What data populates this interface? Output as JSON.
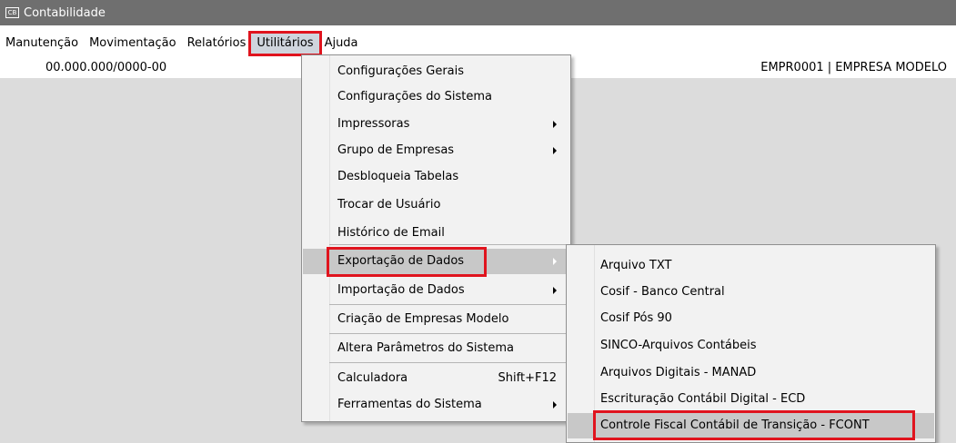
{
  "window": {
    "title": "Contabilidade",
    "icon": "window-app-icon"
  },
  "menubar": {
    "items": [
      {
        "label": "Manutenção"
      },
      {
        "label": "Movimentação"
      },
      {
        "label": "Relatórios"
      },
      {
        "label": "Utilitários"
      },
      {
        "label": "Ajuda"
      }
    ]
  },
  "infobar": {
    "cnpj": "00.000.000/0000-00",
    "empresa": "EMPR0001 | EMPRESA MODELO"
  },
  "utilitarios_menu": {
    "items": [
      {
        "label": "Configurações Gerais"
      },
      {
        "label": "Configurações do Sistema"
      },
      {
        "label": "Impressoras"
      },
      {
        "label": "Grupo de Empresas"
      },
      {
        "label": "Desbloqueia Tabelas"
      },
      {
        "label": "Trocar de Usuário"
      },
      {
        "label": "Histórico de Email"
      },
      {
        "label": "Exportação de Dados"
      },
      {
        "label": "Importação de Dados"
      },
      {
        "label": "Criação de Empresas Modelo"
      },
      {
        "label": "Altera Parâmetros do Sistema"
      },
      {
        "label": "Calculadora",
        "shortcut": "Shift+F12"
      },
      {
        "label": "Ferramentas do Sistema"
      }
    ]
  },
  "exportacao_submenu": {
    "items": [
      {
        "label": "Arquivo TXT"
      },
      {
        "label": "Cosif - Banco Central"
      },
      {
        "label": "Cosif Pós 90"
      },
      {
        "label": "SINCO-Arquivos Contábeis"
      },
      {
        "label": "Arquivos Digitais - MANAD"
      },
      {
        "label": "Escrituração Contábil Digital - ECD"
      },
      {
        "label": "Controle Fiscal Contábil de Transição - FCONT"
      }
    ]
  },
  "highlight_color": "#e0141e"
}
